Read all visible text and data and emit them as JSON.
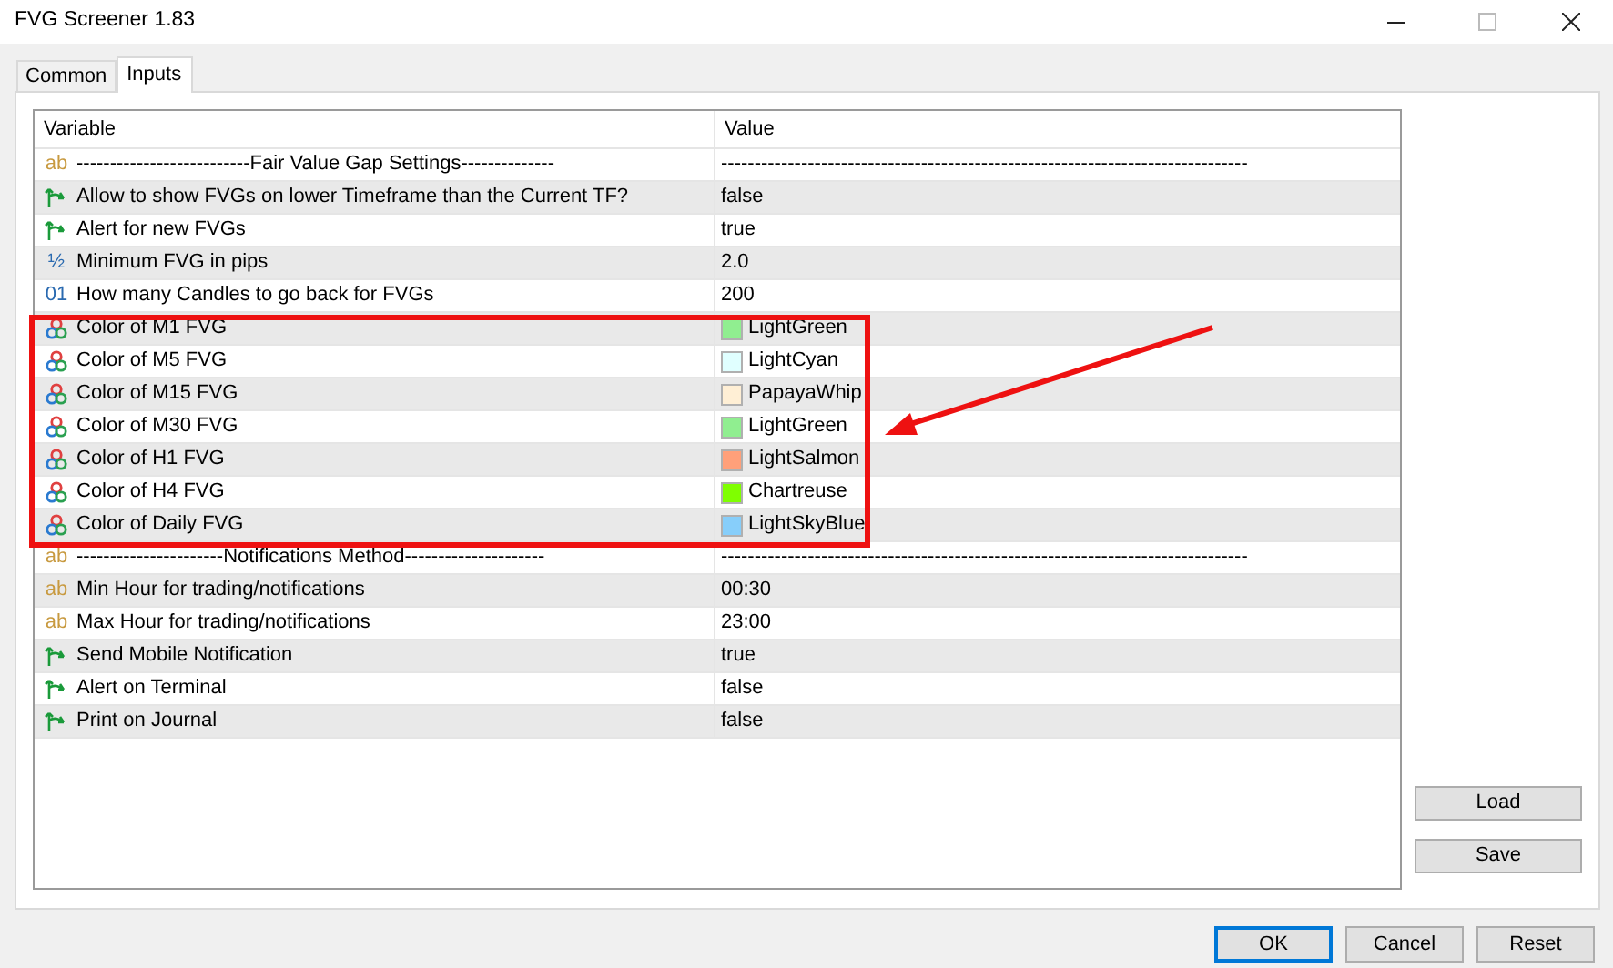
{
  "window": {
    "title": "FVG Screener 1.83"
  },
  "tabs": [
    {
      "label": "Common",
      "selected": false
    },
    {
      "label": "Inputs",
      "selected": true
    }
  ],
  "table": {
    "columns": [
      "Variable",
      "Value"
    ],
    "rows": [
      {
        "kind": "string",
        "icon": "ab",
        "variable": "--------------------------Fair Value Gap Settings--------------",
        "value": "-------------------------------------------------------------------------------"
      },
      {
        "kind": "bool",
        "variable": "Allow to show FVGs on lower Timeframe than the Current TF?",
        "value": "false"
      },
      {
        "kind": "bool",
        "variable": "Alert for new FVGs",
        "value": "true"
      },
      {
        "kind": "double",
        "icon": "½",
        "variable": "Minimum FVG in pips",
        "value": "2.0"
      },
      {
        "kind": "int",
        "icon": "01",
        "variable": "How many Candles to go back for FVGs",
        "value": "200"
      },
      {
        "kind": "color",
        "variable": "Color of M1 FVG",
        "value": "LightGreen",
        "color": "#90ee90"
      },
      {
        "kind": "color",
        "variable": "Color of M5 FVG",
        "value": "LightCyan",
        "color": "#e0ffff"
      },
      {
        "kind": "color",
        "variable": "Color of M15 FVG",
        "value": "PapayaWhip",
        "color": "#ffefd5"
      },
      {
        "kind": "color",
        "variable": "Color of M30 FVG",
        "value": "LightGreen",
        "color": "#90ee90"
      },
      {
        "kind": "color",
        "variable": "Color of H1 FVG",
        "value": "LightSalmon",
        "color": "#ffa07a"
      },
      {
        "kind": "color",
        "variable": "Color of H4 FVG",
        "value": "Chartreuse",
        "color": "#7fff00"
      },
      {
        "kind": "color",
        "variable": "Color of Daily FVG",
        "value": "LightSkyBlue",
        "color": "#87cefa"
      },
      {
        "kind": "string",
        "icon": "ab",
        "variable": "----------------------Notifications Method---------------------",
        "value": "-------------------------------------------------------------------------------"
      },
      {
        "kind": "string",
        "icon": "ab",
        "variable": "Min Hour for trading/notifications",
        "value": "00:30"
      },
      {
        "kind": "string",
        "icon": "ab",
        "variable": "Max Hour for trading/notifications",
        "value": "23:00"
      },
      {
        "kind": "bool",
        "variable": "Send Mobile Notification",
        "value": "true"
      },
      {
        "kind": "bool",
        "variable": "Alert on Terminal",
        "value": "false"
      },
      {
        "kind": "bool",
        "variable": "Print on Journal",
        "value": "false"
      }
    ]
  },
  "side_buttons": [
    "Load",
    "Save"
  ],
  "buttons": [
    {
      "label": "OK",
      "selected": true
    },
    {
      "label": "Cancel",
      "selected": false
    },
    {
      "label": "Reset",
      "selected": false
    }
  ]
}
